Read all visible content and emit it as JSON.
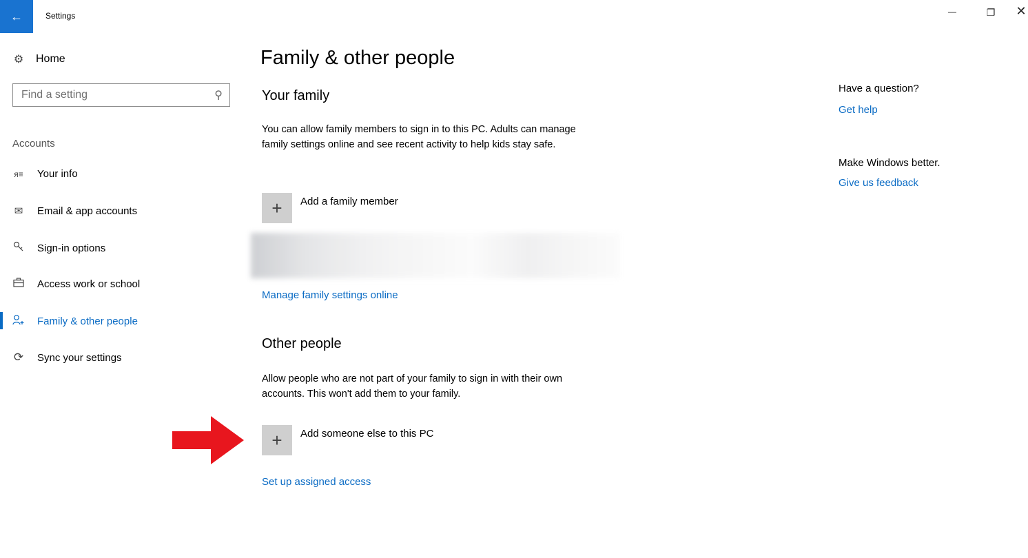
{
  "window": {
    "title": "Settings",
    "back_icon": "←",
    "minimize_icon": "—",
    "restore_icon": "❐",
    "close_icon": "✕"
  },
  "sidebar": {
    "home_label": "Home",
    "search_placeholder": "Find a setting",
    "section_title": "Accounts",
    "items": [
      {
        "label": "Your info",
        "icon": "person-list-icon",
        "glyph": "ᴙ≡"
      },
      {
        "label": "Email & app accounts",
        "icon": "mail-icon",
        "glyph": "✉"
      },
      {
        "label": "Sign-in options",
        "icon": "key-icon",
        "glyph": "🔑"
      },
      {
        "label": "Access work or school",
        "icon": "briefcase-icon",
        "glyph": "💼"
      },
      {
        "label": "Family & other people",
        "icon": "person-add-icon",
        "glyph": "⍥",
        "active": true
      },
      {
        "label": "Sync your settings",
        "icon": "sync-icon",
        "glyph": "⟳"
      }
    ]
  },
  "main": {
    "title": "Family & other people",
    "family": {
      "heading": "Your family",
      "description": "You can allow family members to sign in to this PC. Adults can manage family settings online and see recent activity to help kids stay safe.",
      "add_label": "Add a family member",
      "manage_link": "Manage family settings online"
    },
    "other": {
      "heading": "Other people",
      "description": "Allow people who are not part of your family to sign in with their own accounts. This won't add them to your family.",
      "add_label": "Add someone else to this PC",
      "assigned_link": "Set up assigned access"
    },
    "plus_glyph": "+"
  },
  "right_panel": {
    "question": "Have a question?",
    "help_link": "Get help",
    "better": "Make Windows better.",
    "feedback_link": "Give us feedback"
  },
  "colors": {
    "accent": "#0a6bc4",
    "titlebar_back": "#1973d0",
    "arrow": "#e8161e"
  }
}
